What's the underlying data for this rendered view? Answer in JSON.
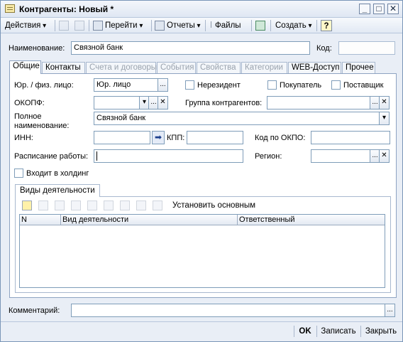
{
  "window": {
    "title": "Контрагенты: Новый *",
    "minimize": "_",
    "maximize": "□",
    "close": "✕"
  },
  "toolbar": {
    "actions": "Действия",
    "goto": "Перейти",
    "reports": "Отчеты",
    "files": "Файлы",
    "create": "Создать",
    "help": "?"
  },
  "header": {
    "name_label": "Наименование:",
    "name_value": "Связной банк",
    "code_label": "Код:",
    "code_value": ""
  },
  "tabs": [
    {
      "label": "Общие",
      "state": "active"
    },
    {
      "label": "Контакты",
      "state": "enabled"
    },
    {
      "label": "Счета и договоры",
      "state": "disabled"
    },
    {
      "label": "События",
      "state": "disabled"
    },
    {
      "label": "Свойства",
      "state": "disabled"
    },
    {
      "label": "Категории",
      "state": "disabled"
    },
    {
      "label": "WEB-Доступ",
      "state": "enabled"
    },
    {
      "label": "Прочее",
      "state": "enabled"
    }
  ],
  "general": {
    "legal_label": "Юр. / физ. лицо:",
    "legal_value": "Юр. лицо",
    "nonresident_label": "Нерезидент",
    "buyer_label": "Покупатель",
    "supplier_label": "Поставщик",
    "okopf_label": "ОКОПФ:",
    "okopf_value": "",
    "group_label": "Группа контрагентов:",
    "group_value": "",
    "fullname_label": "Полное наименование:",
    "fullname_value": "Связной банк",
    "inn_label": "ИНН:",
    "inn_value": "",
    "kpp_label": "КПП:",
    "kpp_value": "",
    "okpo_label": "Код по ОКПО:",
    "okpo_value": "",
    "schedule_label": "Расписание работы:",
    "schedule_value": "",
    "region_label": "Регион:",
    "region_value": "",
    "holding_label": "Входит в холдинг"
  },
  "activities": {
    "tab_label": "Виды деятельности",
    "set_main": "Установить основным",
    "columns": [
      "N",
      "Вид деятельности",
      "Ответственный"
    ]
  },
  "footer": {
    "comment_label": "Комментарий:",
    "comment_value": "",
    "ok": "OK",
    "save": "Записать",
    "close": "Закрыть"
  },
  "symbols": {
    "ellipsis": "...",
    "clear": "✕",
    "dropdown": "▾",
    "arrow_right": "➡"
  }
}
